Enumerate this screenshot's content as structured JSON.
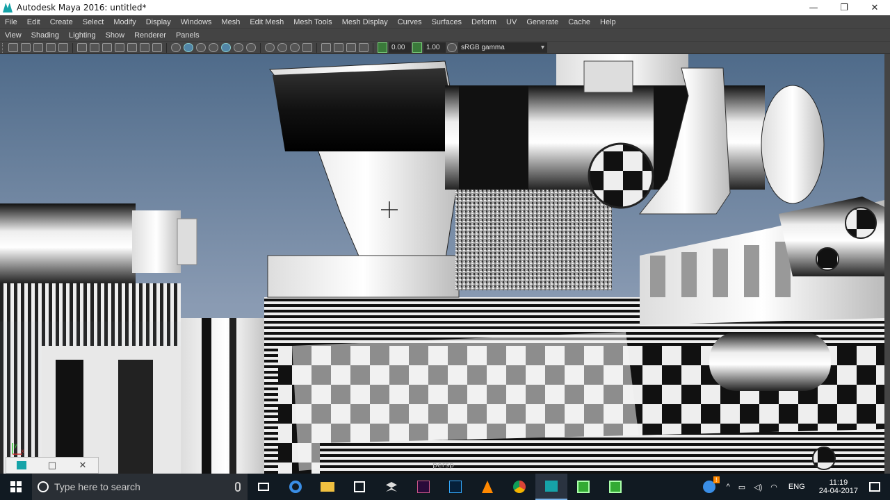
{
  "window": {
    "title": "Autodesk Maya 2016: untitled*",
    "minimize": "—",
    "restore": "❐",
    "close": "✕"
  },
  "menubar": [
    "File",
    "Edit",
    "Create",
    "Select",
    "Modify",
    "Display",
    "Windows",
    "Mesh",
    "Edit Mesh",
    "Mesh Tools",
    "Mesh Display",
    "Curves",
    "Surfaces",
    "Deform",
    "UV",
    "Generate",
    "Cache",
    "Help"
  ],
  "panel_menu": [
    "View",
    "Shading",
    "Lighting",
    "Show",
    "Renderer",
    "Panels"
  ],
  "toolbar": {
    "exposure": "0.00",
    "gamma": "1.00",
    "color_space": "sRGB gamma"
  },
  "viewport": {
    "axis_y": "y",
    "axis_x": "x",
    "camera_label": "persp"
  },
  "mini_window": {
    "restore": "□",
    "close": "✕"
  },
  "taskbar": {
    "search_placeholder": "Type here to search",
    "language": "ENG",
    "time": "11:19",
    "date": "24-04-2017",
    "notification_badge": "!"
  },
  "colors": {
    "maya_accent": "#16a3a8",
    "taskbar": "#111a22",
    "ui_panel": "#444444"
  }
}
